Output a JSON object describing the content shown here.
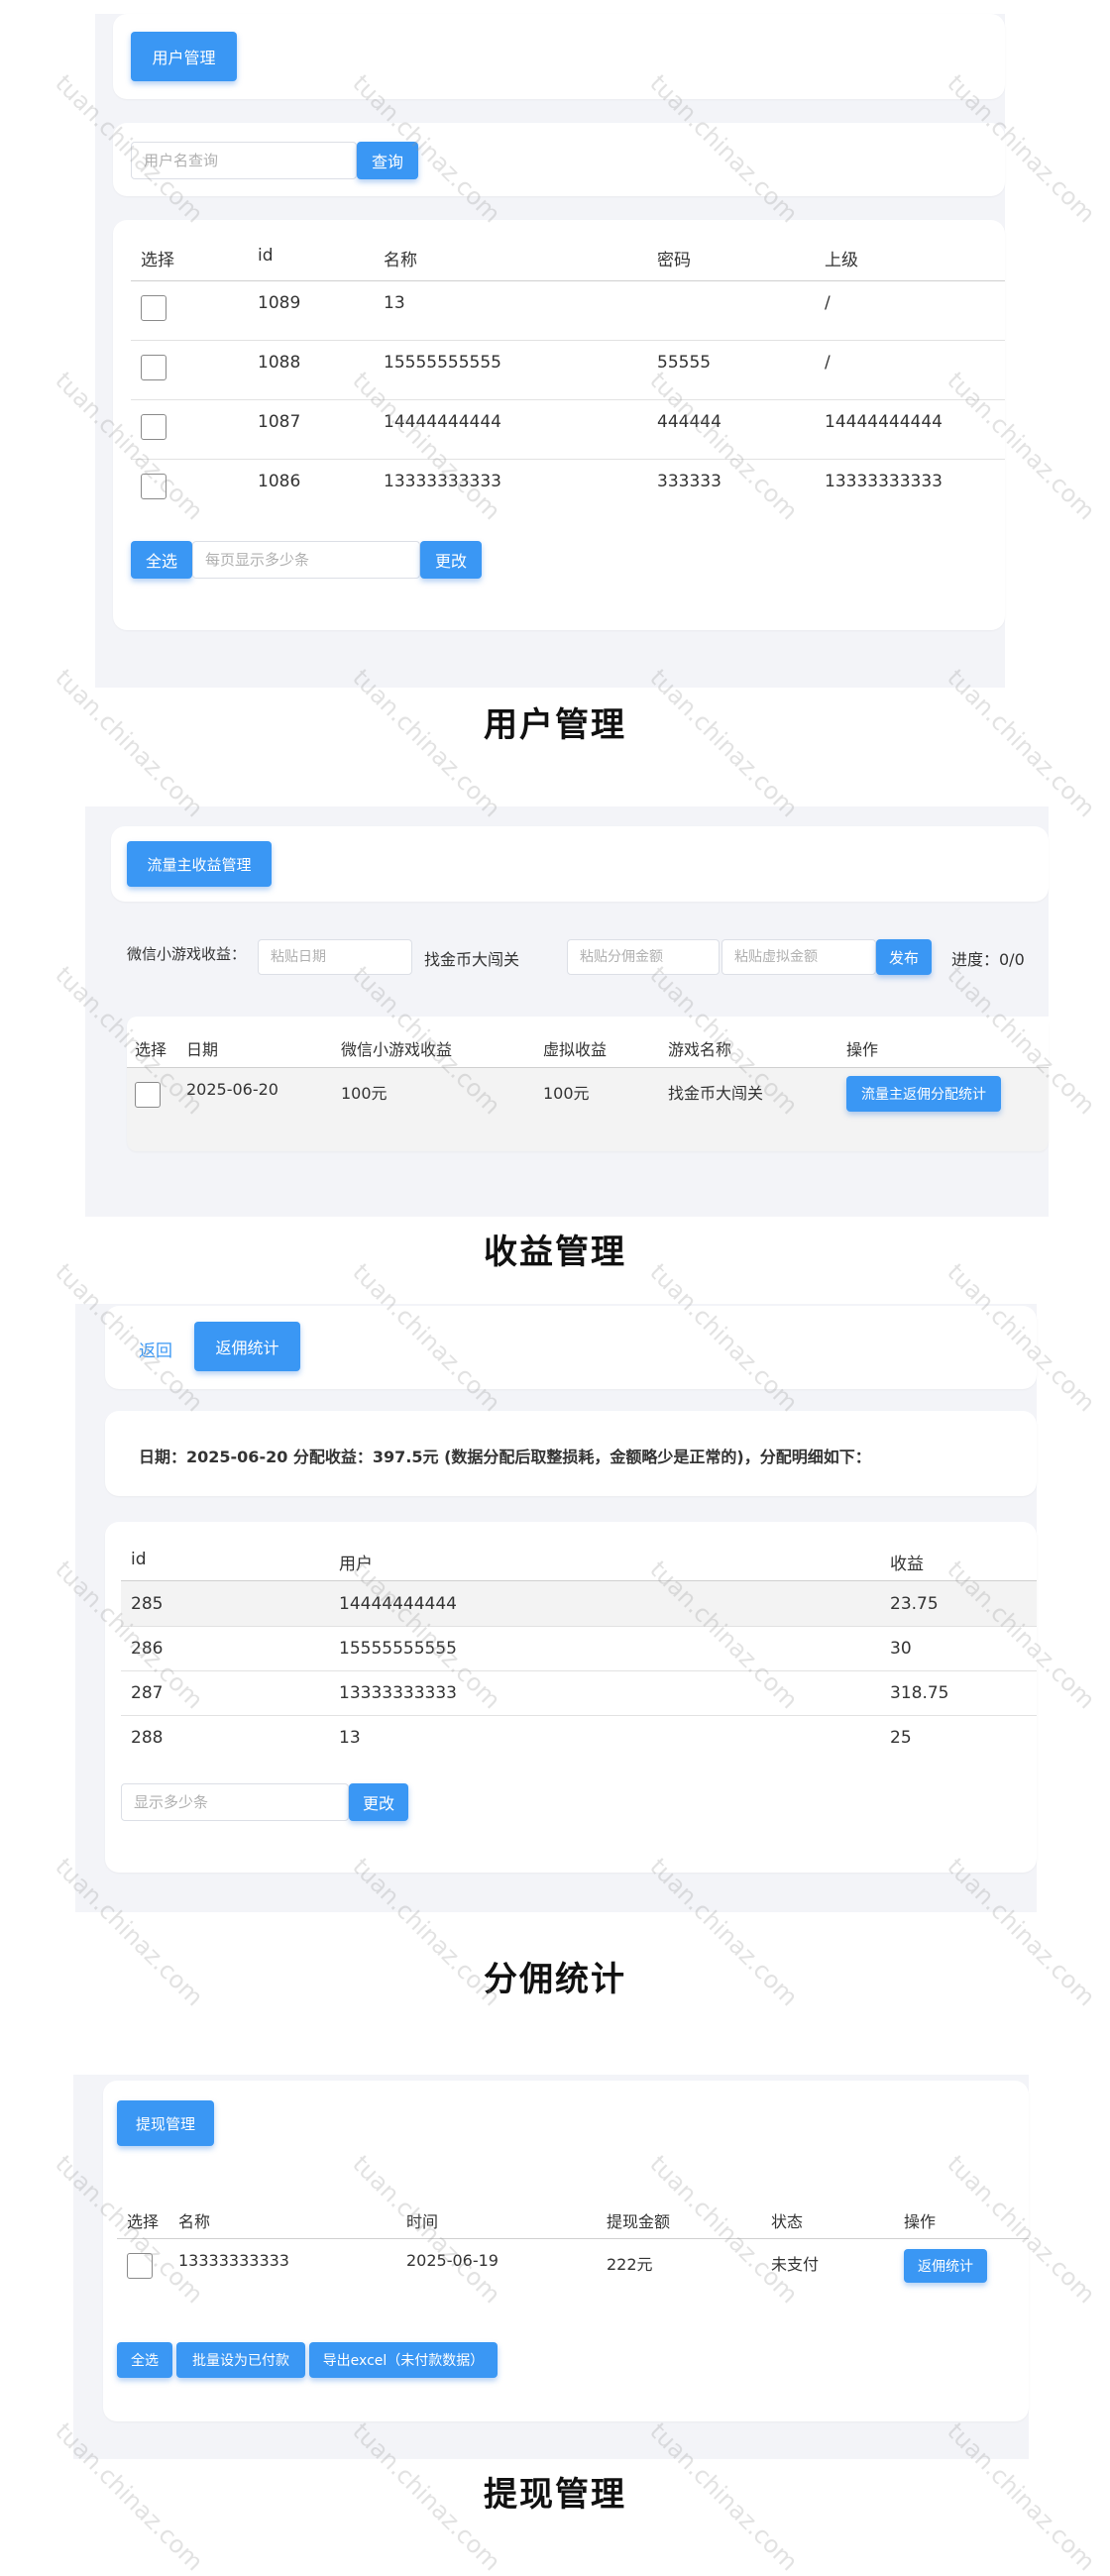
{
  "section1": {
    "title_button": "用户管理",
    "search_placeholder": "用户名查询",
    "search_button": "查询",
    "columns": [
      "选择",
      "id",
      "名称",
      "密码",
      "上级"
    ],
    "rows": [
      {
        "id": "1089",
        "name": "13",
        "password": "",
        "parent": "/"
      },
      {
        "id": "1088",
        "name": "15555555555",
        "password": "55555",
        "parent": "/"
      },
      {
        "id": "1087",
        "name": "14444444444",
        "password": "444444",
        "parent": "14444444444"
      },
      {
        "id": "1086",
        "name": "13333333333",
        "password": "333333",
        "parent": "13333333333"
      }
    ],
    "select_all": "全选",
    "per_page_placeholder": "每页显示多少条",
    "change_button": "更改",
    "caption": "用户管理"
  },
  "section2": {
    "title_button": "流量主收益管理",
    "form_label": "微信小游戏收益：",
    "date_placeholder": "粘贴日期",
    "game_value": "找金币大闯关",
    "split_placeholder": "粘贴分佣金额",
    "virtual_placeholder": "粘贴虚拟金额",
    "publish_button": "发布",
    "progress": "进度：0/0",
    "columns": [
      "选择",
      "日期",
      "微信小游戏收益",
      "虚拟收益",
      "游戏名称",
      "操作"
    ],
    "rows": [
      {
        "date": "2025-06-20",
        "wx_income": "100元",
        "virtual_income": "100元",
        "game": "找金币大闯关",
        "action": "流量主返佣分配统计"
      }
    ],
    "caption": "收益管理"
  },
  "section3": {
    "back_link": "返回",
    "title_button": "返佣统计",
    "summary": "日期：2025-06-20 分配收益：397.5元 (数据分配后取整损耗，金额略少是正常的)，分配明细如下：",
    "columns": [
      "id",
      "用户",
      "收益"
    ],
    "rows": [
      {
        "id": "285",
        "user": "14444444444",
        "income": "23.75"
      },
      {
        "id": "286",
        "user": "15555555555",
        "income": "30"
      },
      {
        "id": "287",
        "user": "13333333333",
        "income": "318.75"
      },
      {
        "id": "288",
        "user": "13",
        "income": "25"
      }
    ],
    "show_placeholder": "显示多少条",
    "change_button": "更改",
    "caption": "分佣统计"
  },
  "section4": {
    "title_button": "提现管理",
    "columns": [
      "选择",
      "名称",
      "时间",
      "提现金额",
      "状态",
      "操作"
    ],
    "rows": [
      {
        "name": "13333333333",
        "time": "2025-06-19",
        "amount": "222元",
        "status": "未支付",
        "action": "返佣统计"
      }
    ],
    "select_all": "全选",
    "batch_paid": "批量设为已付款",
    "export": "导出excel（未付款数据）",
    "caption": "提现管理"
  },
  "watermark": "tuan.chinaz.com",
  "colors": {
    "accent": "#3a97f4",
    "panel": "#f3f4f8",
    "link": "#3a97f4"
  }
}
